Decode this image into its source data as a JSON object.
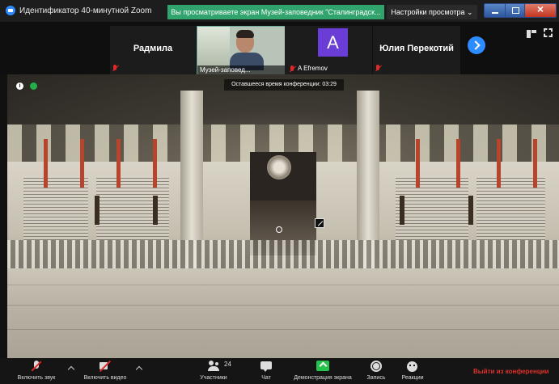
{
  "window": {
    "title": "Идентификатор 40-минутной Zoom",
    "share_banner": "Вы просматриваете экран Музей-заповедник \"Сталинградск...",
    "view_options": "Настройки просмотра ⌄"
  },
  "participants": {
    "tiles": [
      {
        "name": "Радмила",
        "muted": true
      },
      {
        "name": "Музей-заповед...",
        "video": true
      },
      {
        "name": "A Efremov",
        "avatar_letter": "A",
        "muted": true
      },
      {
        "name": "Юлия Перекотий",
        "muted": true
      }
    ]
  },
  "meeting": {
    "timer_text": "Оставшееся время конференции: 03:29"
  },
  "toolbar": {
    "unmute": "Включить звук",
    "start_video": "Включить видео",
    "participants": "Участники",
    "participants_count": "24",
    "chat": "Чат",
    "share": "Демонстрация экрана",
    "record": "Запись",
    "reactions": "Реакции",
    "leave": "Выйти из конференции"
  },
  "colors": {
    "accent": "#2d8cff",
    "share_banner": "#30a46c",
    "avatar": "#6a3ed6",
    "leave": "#e0302a"
  }
}
